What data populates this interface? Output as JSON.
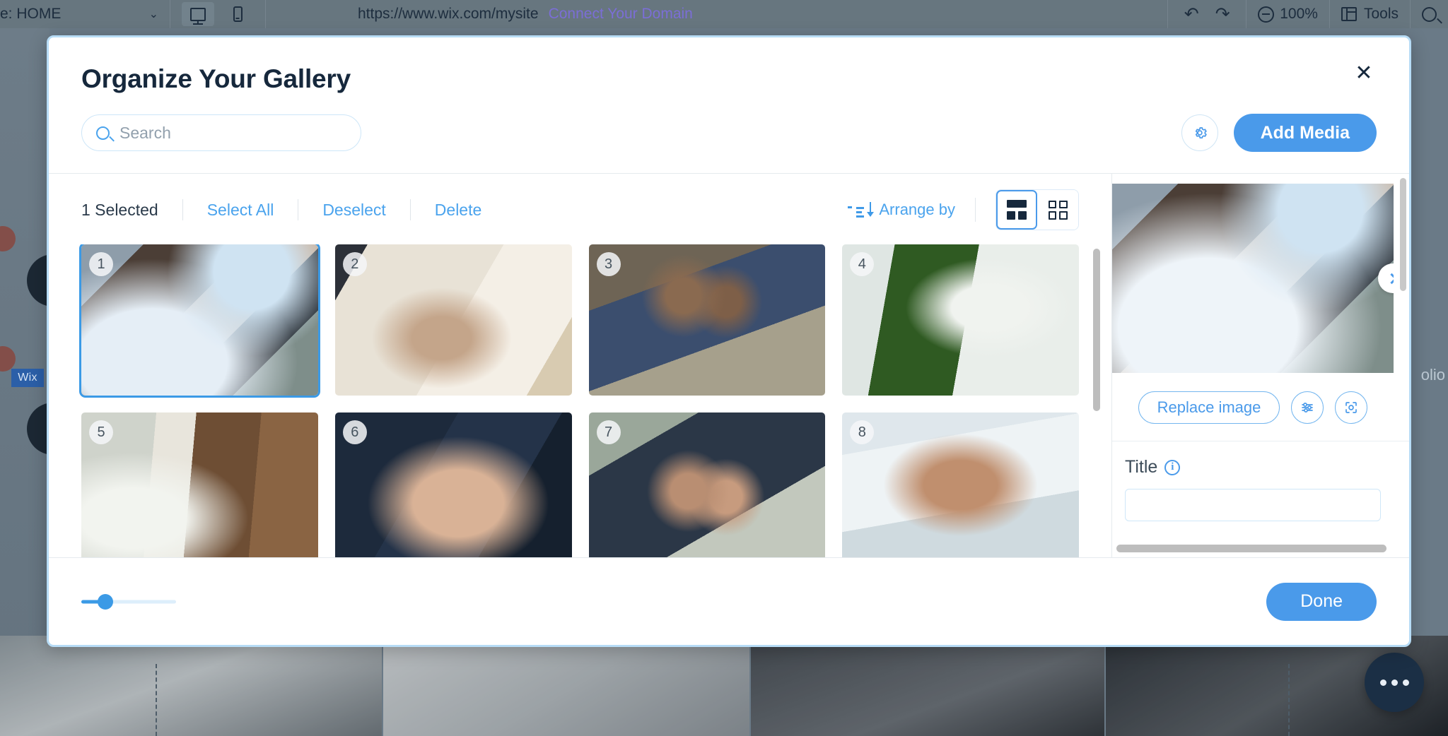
{
  "editor": {
    "page_selector_label": "e: HOME",
    "chevron_icon": "chevron-down-icon",
    "desktop_icon": "desktop-monitor-icon",
    "mobile_icon": "mobile-phone-icon",
    "site_url": "https://www.wix.com/mysite",
    "connect_domain_label": "Connect Your Domain",
    "undo_icon": "undo-arrow-icon",
    "redo_icon": "redo-arrow-icon",
    "zoom_level": "100%",
    "zoom_out_icon": "zoom-out-icon",
    "tools_label": "Tools",
    "tools_icon": "panel-layout-icon",
    "search_icon": "search-icon",
    "wix_badge_label": "Wix",
    "portfolio_label": "olio",
    "chat_icon": "chat-bubble-icon"
  },
  "dialog": {
    "title": "Organize Your Gallery",
    "close_icon": "close-icon",
    "close_label": "✕"
  },
  "search": {
    "placeholder": "Search",
    "value": "",
    "icon": "search-icon"
  },
  "header_actions": {
    "settings_icon": "gear-icon",
    "add_media_label": "Add Media"
  },
  "action_bar": {
    "selected_count_label": "1 Selected",
    "select_all_label": "Select All",
    "deselect_label": "Deselect",
    "delete_label": "Delete",
    "arrange_by_label": "Arrange by",
    "arrange_icon": "sort-descending-icon",
    "view_modes": [
      {
        "name": "view-mode-mixed",
        "icon": "layout-mixed-icon",
        "active": true
      },
      {
        "name": "view-mode-grid",
        "icon": "layout-grid-icon",
        "active": false
      }
    ]
  },
  "gallery": {
    "items": [
      {
        "number": "1",
        "alt": "bride-with-veil-back-view",
        "selected": true
      },
      {
        "number": "2",
        "alt": "hands-with-wedding-ring-on-dress",
        "selected": false
      },
      {
        "number": "3",
        "alt": "couple-foreheads-touching",
        "selected": false
      },
      {
        "number": "4",
        "alt": "babys-breath-jar-on-chair",
        "selected": false
      },
      {
        "number": "5",
        "alt": "rustic-table-setting-flowers",
        "selected": false
      },
      {
        "number": "6",
        "alt": "hands-resting-with-ring",
        "selected": false
      },
      {
        "number": "7",
        "alt": "couple-in-vintage-car",
        "selected": false
      },
      {
        "number": "8",
        "alt": "smiling-bride-flower-crown",
        "selected": false
      }
    ],
    "scrollbar_name": "gallery-vertical-scrollbar"
  },
  "preview": {
    "alt": "bride-with-veil-back-view",
    "next_icon": "chevron-right-icon",
    "replace_label": "Replace image",
    "adjust_icon": "adjust-sliders-icon",
    "focal_icon": "focal-point-icon",
    "title_label": "Title",
    "title_info_icon": "info-icon",
    "title_value": "",
    "title_placeholder": ""
  },
  "footer": {
    "zoom_slider_name": "thumbnail-size-slider",
    "zoom_slider_percent": 25,
    "done_label": "Done"
  },
  "colors": {
    "accent": "#4a9aea",
    "accent_dark": "#3b9ae6",
    "title": "#16283c",
    "modal_border": "#b7dcf6",
    "editor_chrome": "#67767f",
    "link_purple": "#7b6ed6"
  }
}
